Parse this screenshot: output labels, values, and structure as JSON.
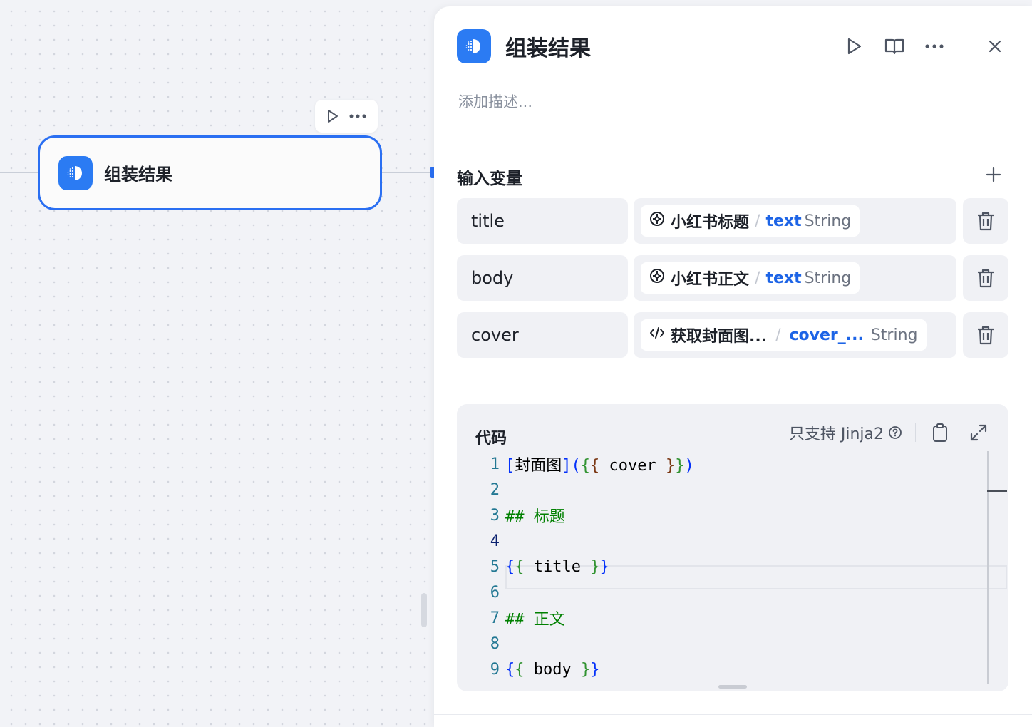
{
  "canvas": {
    "node": {
      "title": "组装结果",
      "icon": "template-icon"
    },
    "node_toolbar": {
      "run_icon": "play-icon",
      "more_icon": "more-dots-icon"
    }
  },
  "panel": {
    "title": "组装结果",
    "description_placeholder": "添加描述...",
    "header_actions": [
      "play-icon",
      "book-icon",
      "more-dots-icon",
      "close-icon"
    ],
    "inputs": {
      "title": "输入变量",
      "add_icon": "plus-icon",
      "rows": [
        {
          "name": "title",
          "source_icon": "agent-icon",
          "source": "小红书标题",
          "field": "text",
          "type": "String"
        },
        {
          "name": "body",
          "source_icon": "agent-icon",
          "source": "小红书正文",
          "field": "text",
          "type": "String"
        },
        {
          "name": "cover",
          "source_icon": "code-icon",
          "source": "获取封面图...",
          "field": "cover_...",
          "type": "String"
        }
      ]
    },
    "code": {
      "title": "代码",
      "support_label": "只支持 Jinja2",
      "active_line": 4,
      "lines": [
        {
          "num": "1",
          "text": "[封面图]({{ cover }})"
        },
        {
          "num": "2",
          "text": ""
        },
        {
          "num": "3",
          "text": "## 标题"
        },
        {
          "num": "4",
          "text": ""
        },
        {
          "num": "5",
          "text": "{{ title }}"
        },
        {
          "num": "6",
          "text": ""
        },
        {
          "num": "7",
          "text": "## 正文"
        },
        {
          "num": "8",
          "text": ""
        },
        {
          "num": "9",
          "text": "{{ body }}"
        }
      ]
    }
  },
  "colors": {
    "accent": "#2a6ff2",
    "field_blue": "#1d64e6",
    "icon_blue": "#2b7bf3"
  }
}
